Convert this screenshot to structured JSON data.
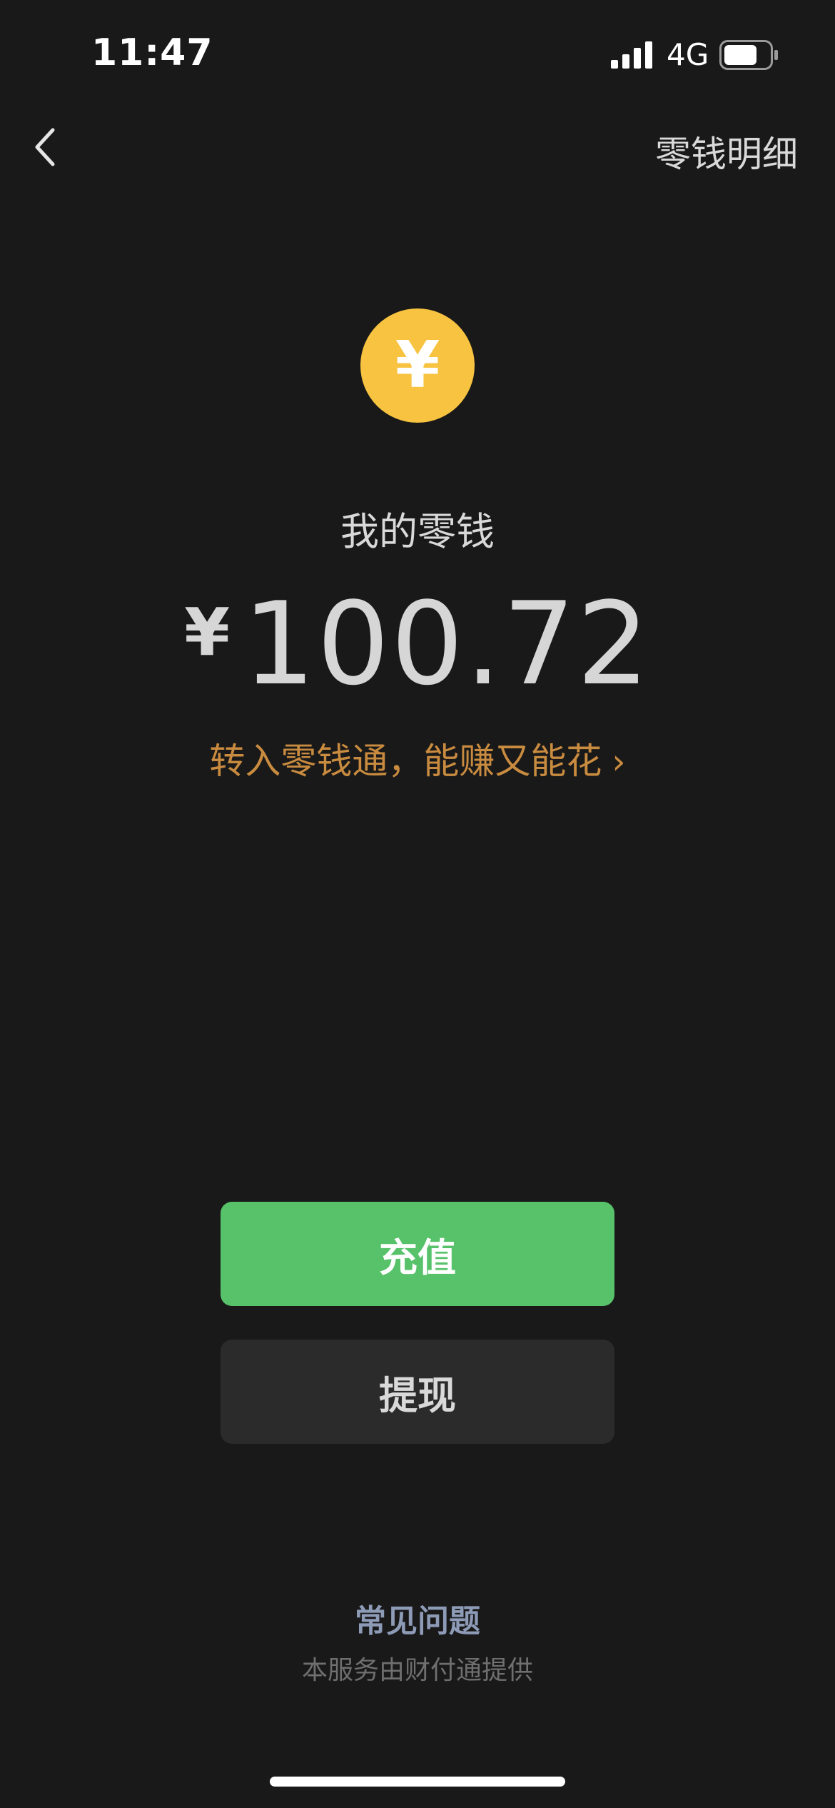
{
  "status_bar": {
    "time": "11:47",
    "network": "4G",
    "icons": [
      "signal-icon",
      "battery-icon"
    ]
  },
  "nav": {
    "back_icon": "chevron-left-icon",
    "right_title": "零钱明细"
  },
  "wallet": {
    "coin_symbol": "¥",
    "label": "我的零钱",
    "currency": "¥",
    "amount": "100.72",
    "promo_text": "转入零钱通，能赚又能花",
    "promo_chevron": "›"
  },
  "actions": {
    "recharge_label": "充值",
    "withdraw_label": "提现"
  },
  "footer": {
    "faq": "常见问题",
    "provider": "本服务由财付通提供"
  },
  "colors": {
    "background": "#191919",
    "coin": "#f7c340",
    "promo": "#c98b3f",
    "primary_button": "#57c26a",
    "secondary_button": "#2b2b2b",
    "faq_link": "#8e9bb7"
  }
}
